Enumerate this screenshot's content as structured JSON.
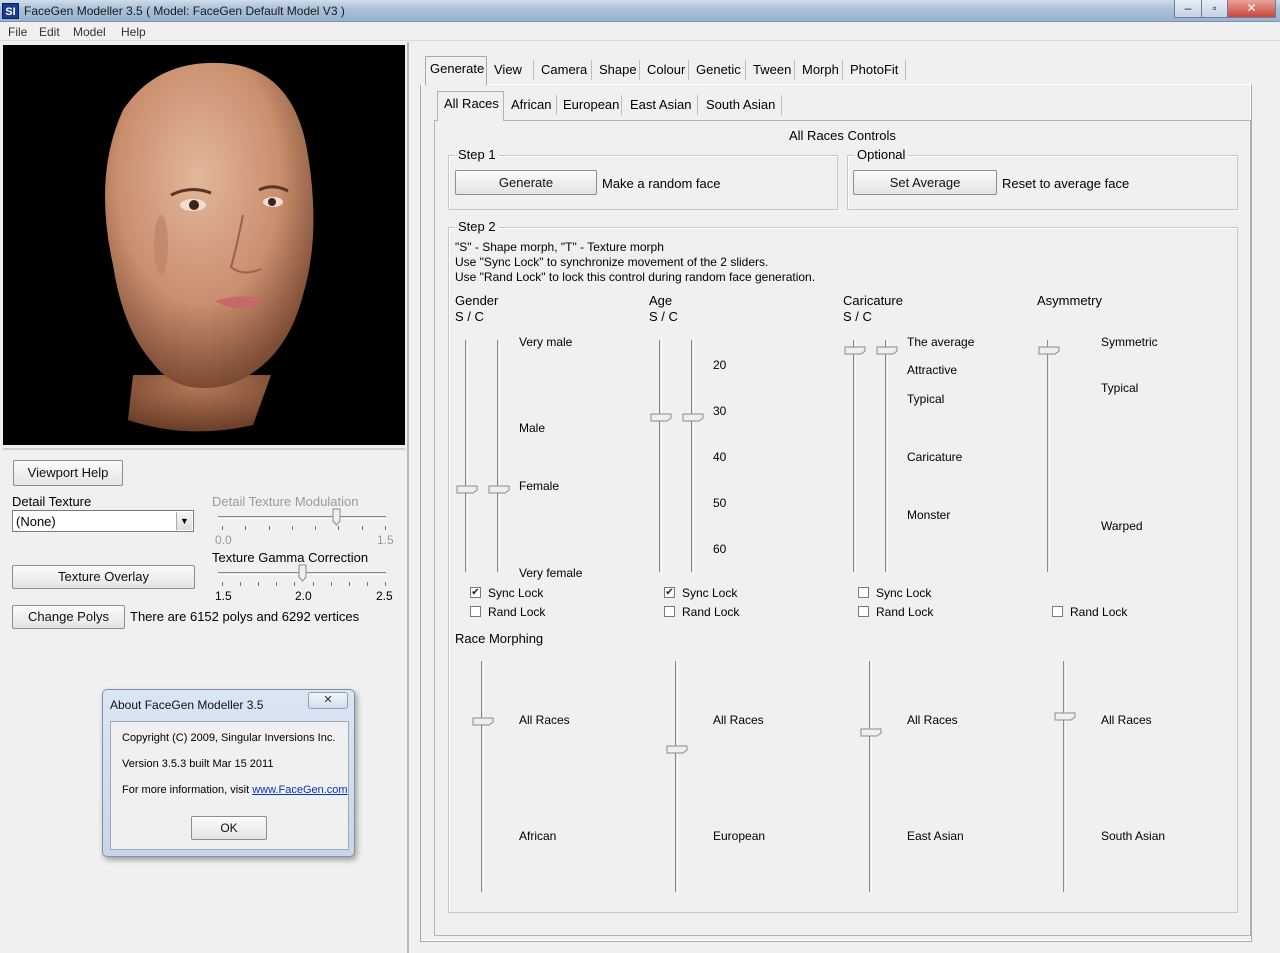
{
  "window": {
    "logo": "SI",
    "title": "FaceGen Modeller 3.5  ( Model: FaceGen Default Model V3 )",
    "minimize": "–",
    "maximize": "▫",
    "close": "✕"
  },
  "menu": [
    "File",
    "Edit",
    "Model",
    "Help"
  ],
  "left": {
    "viewport_help": "Viewport Help",
    "detail_texture": "Detail Texture",
    "detail_texture_value": "(None)",
    "detail_mod": "Detail Texture Modulation",
    "detail_mod_min": "0.0",
    "detail_mod_max": "1.5",
    "detail_mod_value": 1.05,
    "gamma": "Texture Gamma Correction",
    "gamma_ticks": [
      "1.5",
      "2.0",
      "2.5"
    ],
    "gamma_value": 2.0,
    "texture_overlay": "Texture Overlay",
    "change_polys": "Change Polys",
    "polys_info": "There are 6152 polys and 6292 vertices"
  },
  "about": {
    "title": "About FaceGen Modeller 3.5",
    "copyright": "Copyright (C) 2009, Singular Inversions Inc.",
    "version": "Version 3.5.3 built Mar 15 2011",
    "more_info": "For more information, visit ",
    "link": "www.FaceGen.com",
    "ok": "OK"
  },
  "tabs": [
    "Generate",
    "View",
    "Camera",
    "Shape",
    "Colour",
    "Genetic",
    "Tween",
    "Morph",
    "PhotoFit"
  ],
  "subtabs": [
    "All Races",
    "African",
    "European",
    "East Asian",
    "South Asian"
  ],
  "panel": {
    "heading": "All Races Controls",
    "step1": "Step 1",
    "generate": "Generate",
    "generate_desc": "Make a random face",
    "optional": "Optional",
    "set_average": "Set Average",
    "set_average_desc": "Reset to average face",
    "step2": "Step 2",
    "help1": "\"S\" - Shape morph, \"T\" - Texture morph",
    "help2": "Use \"Sync Lock\" to synchronize movement of the 2 sliders.",
    "help3": "Use \"Rand Lock\" to lock this control during random face generation.",
    "sc": "S / C",
    "gender": {
      "title": "Gender",
      "labels": [
        "Very male",
        "Male",
        "Female",
        "Very female"
      ],
      "sync": "Sync Lock",
      "sync_checked": true,
      "rand": "Rand Lock",
      "rand_checked": false
    },
    "age": {
      "title": "Age",
      "labels": [
        "20",
        "30",
        "40",
        "50",
        "60"
      ],
      "sync": "Sync Lock",
      "sync_checked": true,
      "rand": "Rand Lock",
      "rand_checked": false
    },
    "caricature": {
      "title": "Caricature",
      "labels": [
        "The average",
        "Attractive",
        "Typical",
        "Caricature",
        "Monster"
      ],
      "sync": "Sync Lock",
      "sync_checked": false,
      "rand": "Rand Lock",
      "rand_checked": false
    },
    "asymmetry": {
      "title": "Asymmetry",
      "labels": [
        "Symmetric",
        "Typical",
        "Warped"
      ],
      "rand": "Rand Lock",
      "rand_checked": false
    },
    "race_morphing": "Race Morphing",
    "race": [
      {
        "top": "All Races",
        "bottom": "African"
      },
      {
        "top": "All Races",
        "bottom": "European"
      },
      {
        "top": "All Races",
        "bottom": "East Asian"
      },
      {
        "top": "All Races",
        "bottom": "South Asian"
      }
    ]
  },
  "colors": {
    "accent": "#1b3c8c",
    "link": "#0033cc"
  }
}
